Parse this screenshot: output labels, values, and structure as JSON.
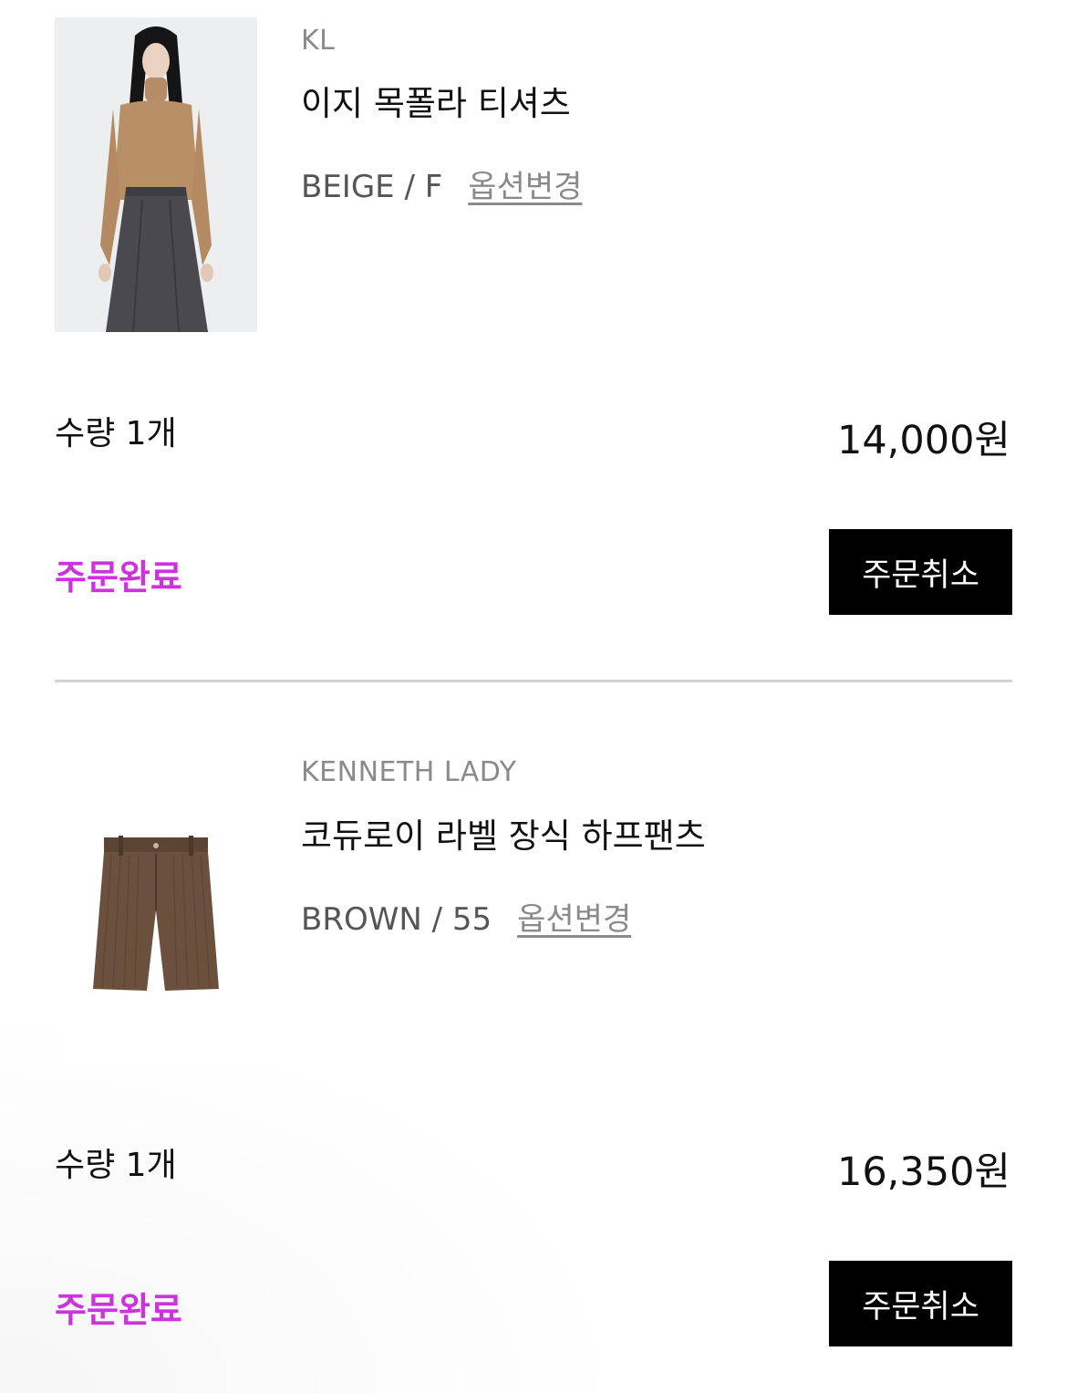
{
  "colors": {
    "status": "#cc33dd",
    "button_bg": "#000000",
    "divider": "#d3d3d3"
  },
  "items": [
    {
      "brand": "KL",
      "name": "이지 목폴라 티셔츠",
      "option": "BEIGE / F",
      "option_change": "옵션변경",
      "quantity": "수량 1개",
      "price": "14,000원",
      "status": "주문완료",
      "cancel_label": "주문취소"
    },
    {
      "brand": "KENNETH LADY",
      "name": "코듀로이 라벨 장식 하프팬츠",
      "option": "BROWN / 55",
      "option_change": "옵션변경",
      "quantity": "수량 1개",
      "price": "16,350원",
      "status": "주문완료",
      "cancel_label": "주문취소"
    }
  ]
}
